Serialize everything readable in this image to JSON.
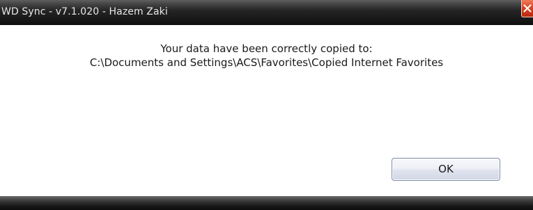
{
  "window": {
    "title": "WD Sync - v7.1.020 - Hazem Zaki"
  },
  "message": {
    "line1": "Your data have been correctly copied to:",
    "line2": "C:\\Documents and Settings\\ACS\\Favorites\\Copied Internet Favorites"
  },
  "buttons": {
    "ok_label": "OK"
  },
  "icons": {
    "close": "close-icon"
  },
  "colors": {
    "titlebar": "#1a1a1a",
    "close_button": "#d9401f",
    "title_text": "#e8e8e8"
  }
}
